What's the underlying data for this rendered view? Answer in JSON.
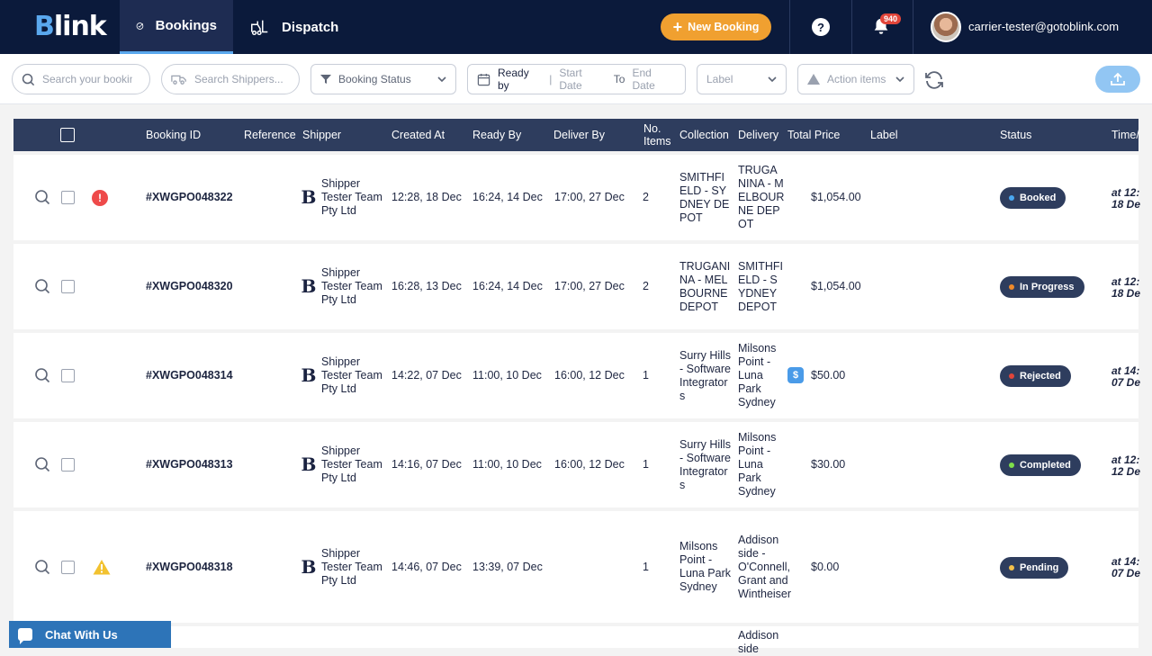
{
  "app": {
    "logo": "Blink"
  },
  "nav": {
    "tabs": [
      {
        "label": "Bookings",
        "active": true
      },
      {
        "label": "Dispatch",
        "active": false
      }
    ],
    "new_booking": "New Booking",
    "help": "?",
    "notifications": "940",
    "user_email": "carrier-tester@gotoblink.com"
  },
  "filters": {
    "search_placeholder": "Search your booking",
    "shipper_placeholder": "Search Shippers...",
    "status": "Booking Status",
    "ready_by": "Ready by",
    "sep": "|",
    "start_date": "Start Date",
    "to": "To",
    "end_date": "End Date",
    "label": "Label",
    "action_items": "Action items"
  },
  "table": {
    "columns": {
      "booking_id": "Booking ID",
      "reference": "Reference",
      "shipper": "Shipper",
      "created_at": "Created At",
      "ready_by": "Ready By",
      "deliver_by": "Deliver By",
      "no_items": "No. Items",
      "collection": "Collection",
      "delivery": "Delivery",
      "total_price": "Total Price",
      "label": "Label",
      "status": "Status",
      "time": "Time/"
    },
    "rows": [
      {
        "id": "#XWGPO048322",
        "shipper": "Shipper Tester Team Pty Ltd",
        "created": "12:28, 18 Dec",
        "ready": "16:24, 14 Dec",
        "deliver": "17:00, 27 Dec",
        "items": "2",
        "collection": "SMITHFIELD - SYDNEY DEPOT",
        "delivery": "TRUGANINA - MELBOURNE DEPOT",
        "price": "$1,054.00",
        "status": "Booked",
        "status_color": "#4aa8f0",
        "time1": "at 12:",
        "time2": "18 De"
      },
      {
        "id": "#XWGPO048320",
        "shipper": "Shipper Tester Team Pty Ltd",
        "created": "16:28, 13 Dec",
        "ready": "16:24, 14 Dec",
        "deliver": "17:00, 27 Dec",
        "items": "2",
        "collection": "TRUGANINA - MELBOURNE DEPOT",
        "delivery": "SMITHFIELD - SYDNEY DEPOT",
        "price": "$1,054.00",
        "status": "In Progress",
        "status_color": "#f08a2a",
        "time1": "at 12:",
        "time2": "18 De"
      },
      {
        "id": "#XWGPO048314",
        "shipper": "Shipper Tester Team Pty Ltd",
        "created": "14:22, 07 Dec",
        "ready": "11:00, 10 Dec",
        "deliver": "16:00, 12 Dec",
        "items": "1",
        "collection": "Surry Hills - Software Integrators",
        "delivery": "Milsons Point - Luna Park Sydney",
        "price": "$50.00",
        "status": "Rejected",
        "status_color": "#e0453a",
        "time1": "at 14:",
        "time2": "07 De"
      },
      {
        "id": "#XWGPO048313",
        "shipper": "Shipper Tester Team Pty Ltd",
        "created": "14:16, 07 Dec",
        "ready": "11:00, 10 Dec",
        "deliver": "16:00, 12 Dec",
        "items": "1",
        "collection": "Surry Hills - Software Integrators",
        "delivery": "Milsons Point - Luna Park Sydney",
        "price": "$30.00",
        "status": "Completed",
        "status_color": "#7ee04a",
        "time1": "at 12:",
        "time2": "12 De"
      },
      {
        "id": "#XWGPO048318",
        "shipper": "Shipper Tester Team Pty Ltd",
        "created": "14:46, 07 Dec",
        "ready": "13:39, 07 Dec",
        "deliver": "",
        "items": "1",
        "collection": "Milsons Point - Luna Park Sydney",
        "delivery": "Addison side - O'Connell, Grant and Wintheiser",
        "price": "$0.00",
        "status": "Pending",
        "status_color": "#f4c04a",
        "time1": "at 14:",
        "time2": "07 De"
      },
      {
        "delivery": "Addison side"
      }
    ]
  },
  "chat": {
    "label": "Chat With Us"
  }
}
